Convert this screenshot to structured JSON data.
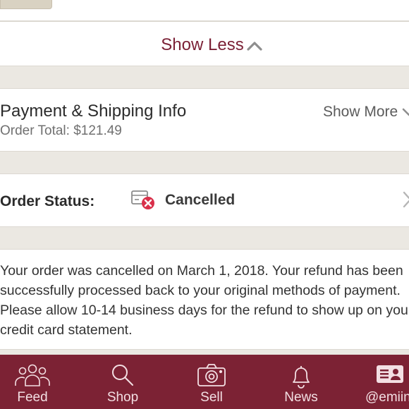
{
  "collapse": {
    "label": "Show Less"
  },
  "payment": {
    "title": "Payment & Shipping Info",
    "order_total": "Order Total: $121.49",
    "expand_label": "Show More"
  },
  "status": {
    "label": "Order Status:",
    "value": "Cancelled",
    "icon": "cancelled-package-icon"
  },
  "message": "Your order was cancelled on March 1, 2018. Your refund has been successfully processed back to your original methods of payment. Please allow 10-14 business days for the refund to show up on your credit card statement.",
  "nav": {
    "items": [
      {
        "label": "Feed",
        "icon": "people-icon"
      },
      {
        "label": "Shop",
        "icon": "search-icon"
      },
      {
        "label": "Sell",
        "icon": "camera-icon"
      },
      {
        "label": "News",
        "icon": "bell-icon"
      },
      {
        "label": "@emiin",
        "icon": "profile-card-icon"
      }
    ]
  },
  "colors": {
    "brand": "#7c2234",
    "background": "#ebe8e2",
    "cancel_badge": "#d9304a"
  }
}
